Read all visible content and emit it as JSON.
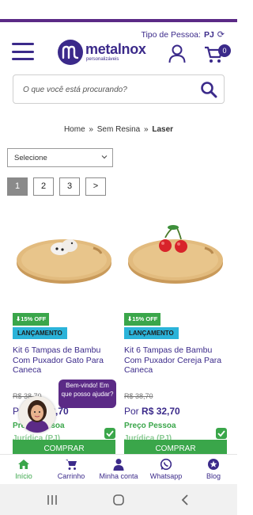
{
  "header": {
    "tipo_label": "Tipo de Pessoa:",
    "tipo_value": "PJ",
    "logo_name": "metalnox",
    "logo_sub": "personalizáveis",
    "cart_count": "0",
    "accent": "#3b2a8a",
    "green": "#3aa64a"
  },
  "search": {
    "placeholder": "O que você está procurando?"
  },
  "breadcrumb": {
    "home": "Home",
    "sep1": "»",
    "category": "Sem Resina",
    "sep2": "»",
    "current": "Laser"
  },
  "filter": {
    "selected": "Selecione"
  },
  "pagination": {
    "pages": [
      "1",
      "2",
      "3"
    ],
    "next": ">"
  },
  "products": [
    {
      "discount": "15% OFF",
      "tag": "LANÇAMENTO",
      "title": "Kit 6 Tampas de Bambu Com Puxador Gato Para Caneca",
      "old_price": "R$ 38,70",
      "price_prefix": "Por",
      "price": "R$ 32,70",
      "person_label": "Preço Pessoa",
      "person_type": "Jurídica (PJ)",
      "buy_label": "COMPRAR"
    },
    {
      "discount": "15% OFF",
      "tag": "LANÇAMENTO",
      "title": "Kit 6 Tampas de Bambu Com Puxador Cereja Para Caneca",
      "old_price": "R$ 38,70",
      "price_prefix": "Por",
      "price": "R$ 32,70",
      "person_label": "Preço Pessoa",
      "person_type": "Jurídica (PJ)",
      "buy_label": "COMPRAR"
    }
  ],
  "chat": {
    "bubble": "Bem-vindo! Em que posso ajudar?"
  },
  "bottom_nav": [
    {
      "label": "Início",
      "icon": "home-icon"
    },
    {
      "label": "Carrinho",
      "icon": "cart-icon"
    },
    {
      "label": "Minha conta",
      "icon": "user-icon"
    },
    {
      "label": "Whatsapp",
      "icon": "whatsapp-icon"
    },
    {
      "label": "Blog",
      "icon": "star-icon"
    }
  ]
}
